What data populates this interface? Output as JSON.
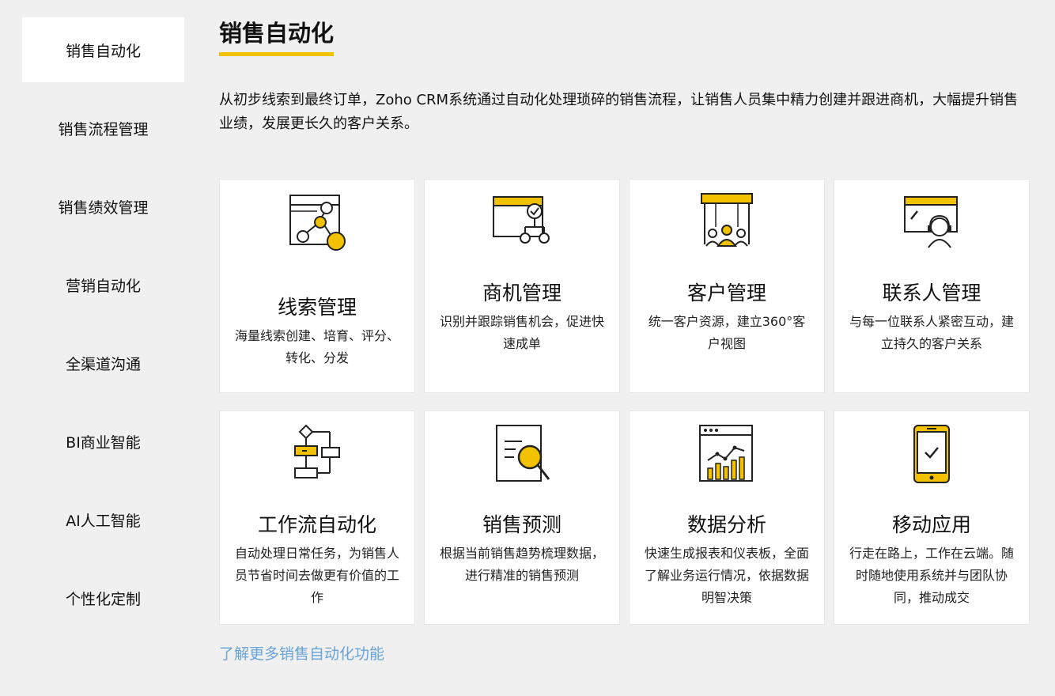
{
  "sidebar": {
    "items": [
      {
        "label": "销售自动化",
        "active": true
      },
      {
        "label": "销售流程管理"
      },
      {
        "label": "销售绩效管理"
      },
      {
        "label": "营销自动化"
      },
      {
        "label": "全渠道沟通"
      },
      {
        "label": "BI商业智能"
      },
      {
        "label": "AI人工智能"
      },
      {
        "label": "个性化定制"
      }
    ]
  },
  "main": {
    "title": "销售自动化",
    "intro": "从初步线索到最终订单，Zoho CRM系统通过自动化处理琐碎的销售流程，让销售人员集中精力创建并跟进商机，大幅提升销售业绩，发展更长久的客户关系。",
    "cards": [
      {
        "title": "线索管理",
        "desc": "海量线索创建、培育、评分、转化、分发",
        "icon": "lead-flow-icon"
      },
      {
        "title": "商机管理",
        "desc": "识别并跟踪销售机会，促进快速成单",
        "icon": "deal-pipeline-icon"
      },
      {
        "title": "客户管理",
        "desc": "统一客户资源，建立360°客户视图",
        "icon": "customer-group-icon"
      },
      {
        "title": "联系人管理",
        "desc": "与每一位联系人紧密互动，建立持久的客户关系",
        "icon": "contact-headset-icon"
      },
      {
        "title": "工作流自动化",
        "desc": "自动处理日常任务，为销售人员节省时间去做更有价值的工作",
        "icon": "workflow-icon"
      },
      {
        "title": "销售预测",
        "desc": "根据当前销售趋势梳理数据，进行精准的销售预测",
        "icon": "forecast-magnifier-icon"
      },
      {
        "title": "数据分析",
        "desc": "快速生成报表和仪表板，全面了解业务运行情况，依据数据明智决策",
        "icon": "analytics-chart-icon"
      },
      {
        "title": "移动应用",
        "desc": "行走在路上，工作在云端。随时随地使用系统并与团队协同，推动成交",
        "icon": "mobile-phone-icon"
      }
    ],
    "more_link": "了解更多销售自动化功能"
  },
  "colors": {
    "accent": "#f2c200",
    "link": "#6aa3d8",
    "background": "#f0f0f0"
  }
}
